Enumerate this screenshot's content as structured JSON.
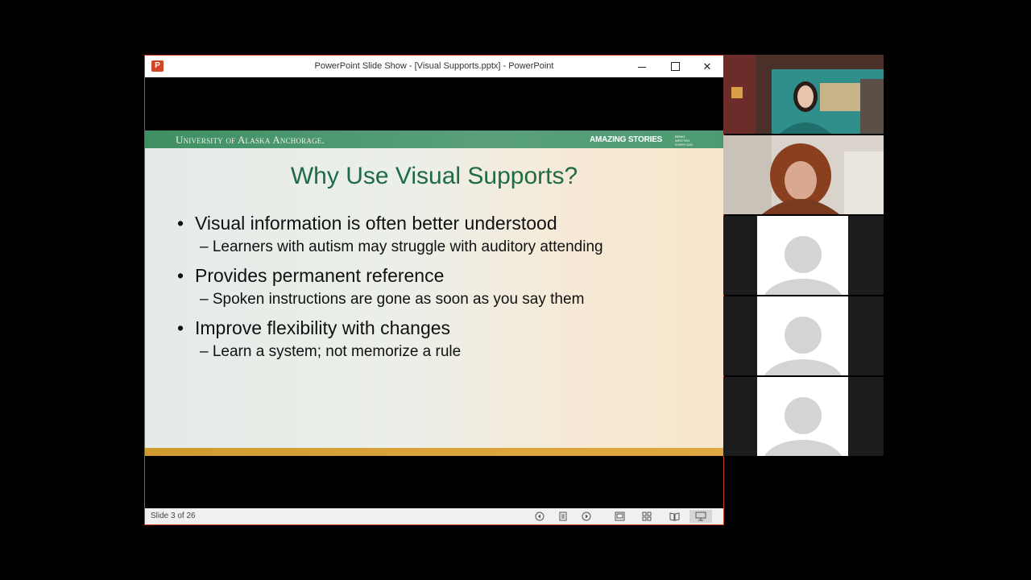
{
  "window": {
    "app_icon_letter": "P",
    "title": "PowerPoint Slide Show - [Visual Supports.pptx] - PowerPoint",
    "minimize": "–",
    "close": "✕"
  },
  "slide": {
    "header_left": "University of Alaska Anchorage.",
    "header_right": "AMAZING STORIES",
    "header_right_small": "BEING WRITTEN EVERY DAY",
    "title": "Why Use Visual Supports?",
    "bullets": [
      {
        "text": "Visual information is often better understood",
        "sub": "– Learners with autism may struggle with auditory attending"
      },
      {
        "text": "Provides permanent reference",
        "sub": "– Spoken instructions are gone as soon as you say them"
      },
      {
        "text": "Improve flexibility with changes",
        "sub": "– Learn a system; not memorize a rule"
      }
    ],
    "bullet_char": "•"
  },
  "statusbar": {
    "slide_label": "Slide 3 of 26"
  },
  "video_tiles": [
    {
      "type": "camera",
      "label": "participant-1"
    },
    {
      "type": "camera",
      "label": "participant-2"
    },
    {
      "type": "placeholder"
    },
    {
      "type": "placeholder"
    },
    {
      "type": "placeholder"
    }
  ],
  "colors": {
    "title_green": "#1f6b45",
    "header_green": "#4d9a72",
    "footer_gold": "#d9a53a",
    "ppt_red": "#d24726"
  }
}
